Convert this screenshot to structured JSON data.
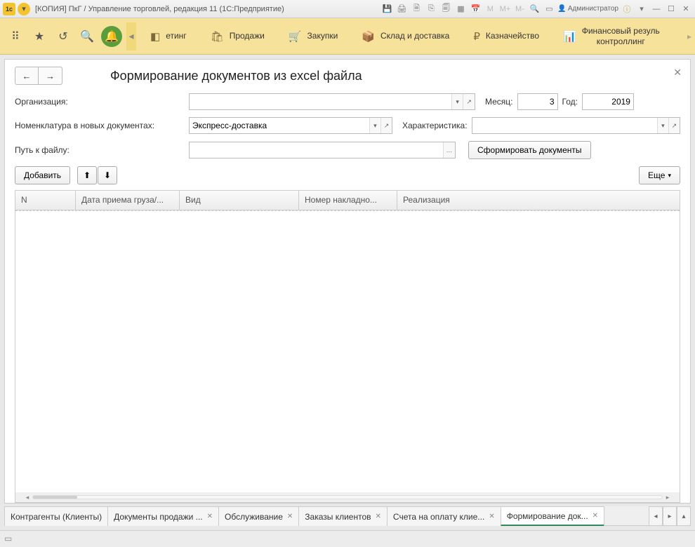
{
  "titlebar": {
    "title": "[КОПИЯ] ПкГ / Управление торговлей, редакция 11  (1С:Предприятие)",
    "user": "Администратор",
    "m_labels": [
      "M",
      "M+",
      "M-"
    ]
  },
  "navbar": {
    "sections": [
      {
        "icon": "◧",
        "label": "етинг"
      },
      {
        "icon": "🛍",
        "label": "Продажи"
      },
      {
        "icon": "🛒",
        "label": "Закупки"
      },
      {
        "icon": "📦",
        "label": "Склад и доставка"
      },
      {
        "icon": "₽",
        "label": "Казначейство"
      },
      {
        "icon": "📊",
        "label": "Финансовый резуль\nконтроллинг"
      }
    ]
  },
  "page": {
    "title": "Формирование документов из excel файла",
    "labels": {
      "org": "Организация:",
      "month": "Месяц:",
      "year": "Год:",
      "nomenclature": "Номенклатура в новых документах:",
      "characteristic": "Характеристика:",
      "filepath": "Путь к файлу:"
    },
    "values": {
      "org": "",
      "month": "3",
      "year": "2019",
      "nomenclature": "Экспресс-доставка",
      "characteristic": "",
      "filepath": ""
    },
    "buttons": {
      "generate": "Сформировать документы",
      "add": "Добавить",
      "more": "Еще"
    },
    "columns": [
      "N",
      "Дата приема груза/...",
      "Вид",
      "Номер накладно...",
      "Реализация"
    ]
  },
  "tabs": [
    {
      "label": "Контрагенты (Клиенты)",
      "closable": false,
      "active": false
    },
    {
      "label": "Документы продажи ...",
      "closable": true,
      "active": false
    },
    {
      "label": "Обслуживание",
      "closable": true,
      "active": false
    },
    {
      "label": "Заказы клиентов",
      "closable": true,
      "active": false
    },
    {
      "label": "Счета на оплату клие...",
      "closable": true,
      "active": false
    },
    {
      "label": "Формирование док...",
      "closable": true,
      "active": true
    }
  ]
}
